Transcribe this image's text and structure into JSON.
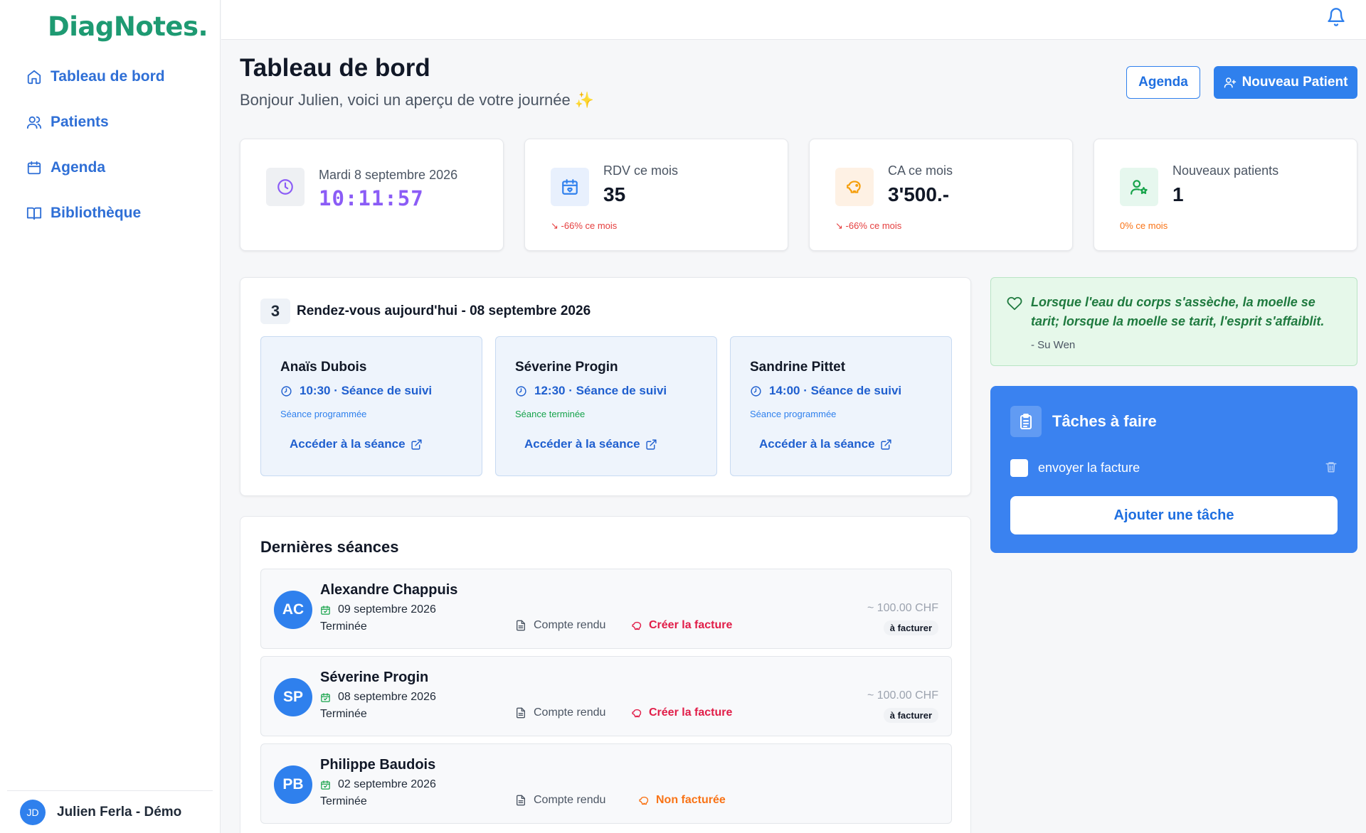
{
  "app": {
    "logo": "DiagNotes."
  },
  "sidebar": {
    "items": [
      {
        "label": "Tableau de bord",
        "icon": "home-icon"
      },
      {
        "label": "Patients",
        "icon": "users-icon"
      },
      {
        "label": "Agenda",
        "icon": "calendar-icon"
      },
      {
        "label": "Bibliothèque",
        "icon": "book-icon"
      }
    ],
    "user": {
      "initials": "JD",
      "name": "Julien Ferla - Démo"
    }
  },
  "header": {
    "title": "Tableau de bord",
    "subtitle": "Bonjour Julien, voici un aperçu de votre journée ✨",
    "agenda_button": "Agenda",
    "new_patient_button": "Nouveau Patient"
  },
  "stats": {
    "clock": {
      "date": "Mardi 8 septembre 2026",
      "time": "10:11:57"
    },
    "rdv": {
      "label": "RDV ce mois",
      "value": "35",
      "trend": "-66% ce mois"
    },
    "ca": {
      "label": "CA ce mois",
      "value": "3'500.-",
      "trend": "-66% ce mois"
    },
    "new_patients": {
      "label": "Nouveaux patients",
      "value": "1",
      "trend": "0% ce mois"
    }
  },
  "appointments": {
    "count": "3",
    "title": "Rendez-vous aujourd'hui - 08 septembre 2026",
    "items": [
      {
        "name": "Anaïs Dubois",
        "time": "10:30 · Séance de suivi",
        "status": "Séance programmée",
        "link": "Accéder à la séance"
      },
      {
        "name": "Séverine Progin",
        "time": "12:30 · Séance de suivi",
        "status": "Séance terminée",
        "link": "Accéder à la séance"
      },
      {
        "name": "Sandrine Pittet",
        "time": "14:00 · Séance de suivi",
        "status": "Séance programmée",
        "link": "Accéder à la séance"
      }
    ]
  },
  "sessions": {
    "title": "Dernières séances",
    "items": [
      {
        "initials": "AC",
        "name": "Alexandre Chappuis",
        "date": "09 septembre 2026",
        "status": "Terminée",
        "report": "Compte rendu",
        "invoice": "Créer la facture",
        "price": "~ 100.00 CHF",
        "badge": "à facturer"
      },
      {
        "initials": "SP",
        "name": "Séverine Progin",
        "date": "08 septembre 2026",
        "status": "Terminée",
        "report": "Compte rendu",
        "invoice": "Créer la facture",
        "price": "~ 100.00 CHF",
        "badge": "à facturer"
      },
      {
        "initials": "PB",
        "name": "Philippe Baudois",
        "date": "02 septembre 2026",
        "status": "Terminée",
        "report": "Compte rendu",
        "invoice": "Non facturée"
      }
    ]
  },
  "quote": {
    "text": "Lorsque l'eau du corps s'assèche, la moelle se tarit; lorsque la moelle se tarit, l'esprit s'affaiblit.",
    "author": "- Su Wen"
  },
  "tasks": {
    "title": "Tâches à faire",
    "items": [
      {
        "label": "envoyer la facture"
      }
    ],
    "add_button": "Ajouter une tâche"
  },
  "colors": {
    "primary": "#2f80ed",
    "brand_green": "#1e9a72",
    "trend_red": "#e53e3e",
    "trend_orange": "#f97316",
    "status_blue": "#2f80ed",
    "status_green": "#16a34a",
    "invoice_red": "#e11d48",
    "invoice_orange": "#f97316",
    "clock_purple": "#8b5cf6"
  }
}
